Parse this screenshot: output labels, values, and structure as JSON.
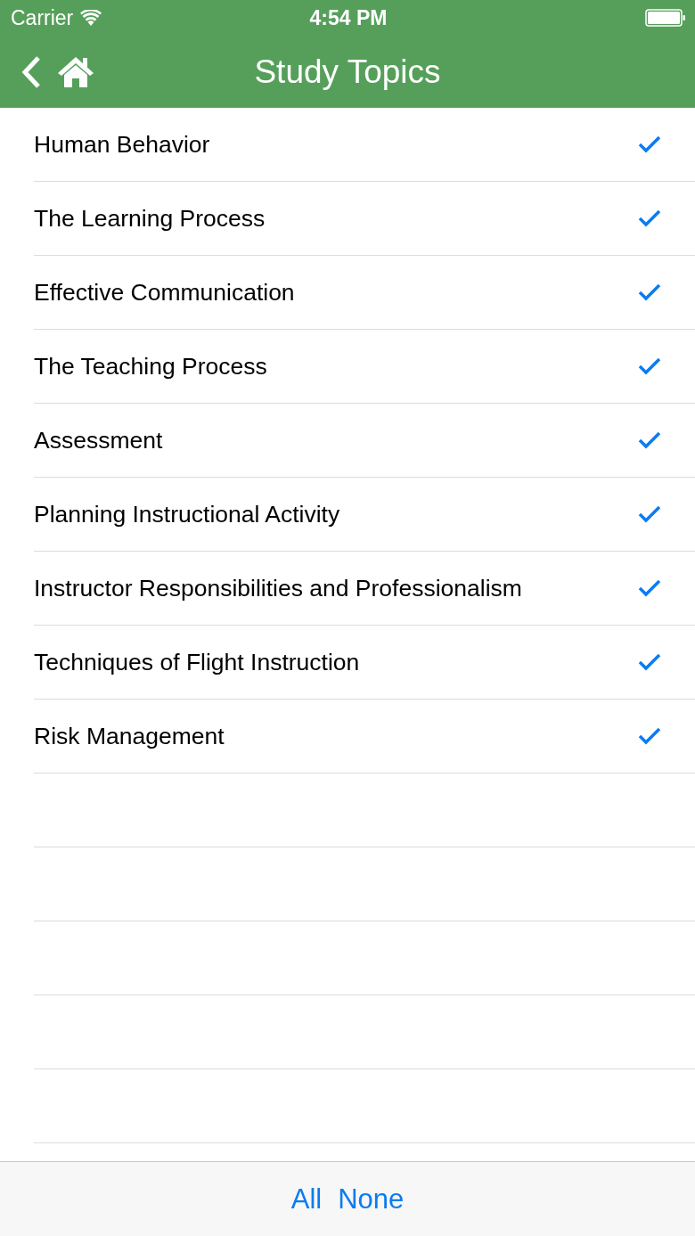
{
  "status_bar": {
    "carrier": "Carrier",
    "time": "4:54 PM"
  },
  "nav_bar": {
    "title": "Study Topics"
  },
  "topics": [
    {
      "label": "Human Behavior",
      "checked": true
    },
    {
      "label": "The Learning Process",
      "checked": true
    },
    {
      "label": "Effective Communication",
      "checked": true
    },
    {
      "label": "The Teaching Process",
      "checked": true
    },
    {
      "label": "Assessment",
      "checked": true
    },
    {
      "label": "Planning Instructional Activity",
      "checked": true
    },
    {
      "label": "Instructor Responsibilities and Professionalism",
      "checked": true
    },
    {
      "label": "Techniques of Flight Instruction",
      "checked": true
    },
    {
      "label": "Risk Management",
      "checked": true
    }
  ],
  "toolbar": {
    "buttons": [
      "All",
      "None"
    ]
  }
}
